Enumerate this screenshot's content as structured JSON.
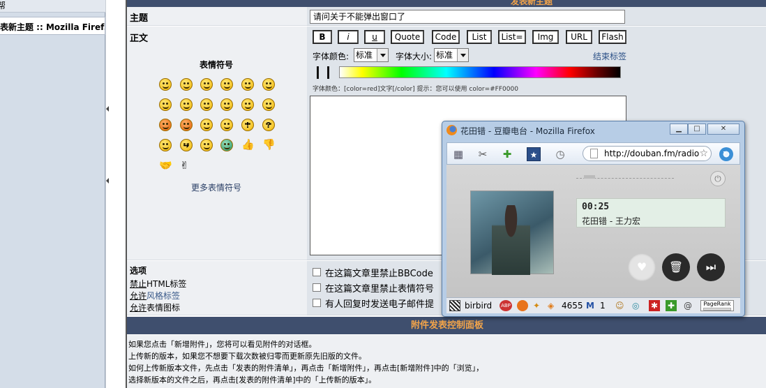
{
  "left_pane": {
    "top_label": "帮",
    "window_item": "表新主题 :: Mozilla Firef..."
  },
  "form": {
    "header_title": "发表新主题",
    "subject_label": "主题",
    "subject_value": "请问关于不能弹出窗口了",
    "body_label": "正文",
    "emoticons_title": "表情符号",
    "more_emoticons": "更多表情符号",
    "bbcode_buttons": [
      "B",
      "i",
      "u",
      "Quote",
      "Code",
      "List",
      "List=",
      "Img",
      "URL",
      "Flash"
    ],
    "font_color_label": "字体颜色:",
    "font_color_value": "标准",
    "font_size_label": "字体大小:",
    "font_size_value": "标准",
    "close_tags": "结束标签",
    "hint": "字体颜色：[color=red]文字[/color]  提示：您可以使用 color=#FF0000",
    "options_label": "选项",
    "options": [
      {
        "prefix": "禁止",
        "rest": "HTML标签"
      },
      {
        "prefix": "允许",
        "rest": "风格标签"
      },
      {
        "prefix": "允许",
        "rest": "表情图标"
      }
    ],
    "checkboxes": [
      "在这篇文章里禁止BBCode",
      "在这篇文章里禁止表情符号",
      "有人回复时发送电子邮件提"
    ]
  },
  "attachments": {
    "title": "附件发表控制面板",
    "lines": [
      "如果您点击「新增附件」，您将可以看见附件的对话框。",
      "上传新的版本，如果您不想要下载次数被归零而更新原先旧版的文件。",
      "如何上传新版本文件，先点击「发表的附件清单」，再点击「新增附件」，再点击[新增附件]中的「浏览」，",
      "选择新版本的文件之后，再点击[发表的附件清单]中的「上传新的版本」。"
    ]
  },
  "firefox": {
    "title": "花田错 - 豆瓣电台 - Mozilla Firefox",
    "url": "http://douban.fm/radio",
    "player": {
      "time": "00:25",
      "song": "花田错 - 王力宏"
    },
    "status": {
      "user": "birbird",
      "count1": "4655",
      "count2": "1",
      "pagerank": "PageRank"
    }
  }
}
